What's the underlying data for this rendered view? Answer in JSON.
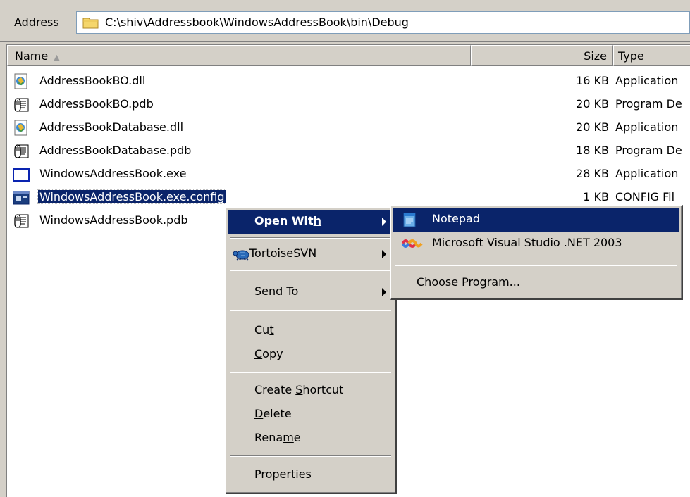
{
  "address": {
    "label": "Address",
    "label_accel": "d",
    "path": "C:\\shiv\\Addressbook\\WindowsAddressBook\\bin\\Debug"
  },
  "columns": {
    "name": "Name",
    "size": "Size",
    "type": "Type"
  },
  "files": [
    {
      "name": "AddressBookBO.dll",
      "size": "16 KB",
      "type": "Application",
      "icon": "dll-icon"
    },
    {
      "name": "AddressBookBO.pdb",
      "size": "20 KB",
      "type": "Program De",
      "icon": "pdb-icon"
    },
    {
      "name": "AddressBookDatabase.dll",
      "size": "20 KB",
      "type": "Application",
      "icon": "dll-icon"
    },
    {
      "name": "AddressBookDatabase.pdb",
      "size": "18 KB",
      "type": "Program De",
      "icon": "pdb-icon"
    },
    {
      "name": "WindowsAddressBook.exe",
      "size": "28 KB",
      "type": "Application",
      "icon": "exe-icon"
    },
    {
      "name": "WindowsAddressBook.exe.config",
      "size": "1 KB",
      "type": "CONFIG Fil",
      "icon": "config-icon",
      "selected": true
    },
    {
      "name": "WindowsAddressBook.pdb",
      "size": "",
      "type": "",
      "icon": "pdb-icon"
    }
  ],
  "context_menu": {
    "open_with": "Open With",
    "tortoise": "TortoiseSVN",
    "send_to": "Send To",
    "cut": "Cut",
    "copy": "Copy",
    "create_shortcut": "Create Shortcut",
    "delete": "Delete",
    "rename": "Rename",
    "properties": "Properties"
  },
  "submenu": {
    "notepad": "Notepad",
    "visual_studio": "Microsoft Visual Studio .NET 2003",
    "choose_program": "Choose Program..."
  },
  "colors": {
    "selection": "#0a246a",
    "face": "#d4d0c8"
  }
}
